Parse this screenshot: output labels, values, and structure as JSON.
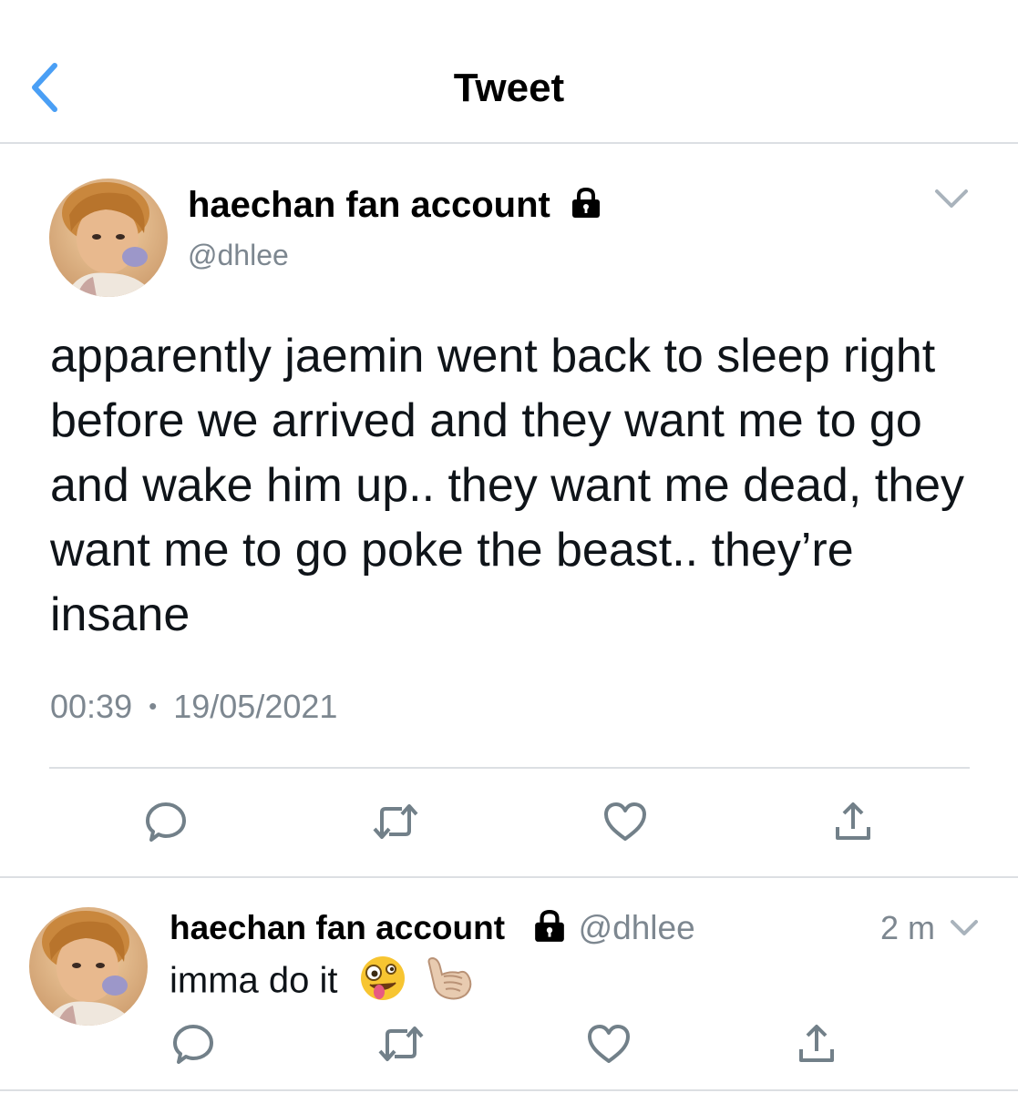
{
  "header": {
    "title": "Tweet",
    "back_icon": "chevron-left-icon"
  },
  "tweet": {
    "display_name": "haechan fan account",
    "handle": "@dhlee",
    "protected_icon": "lock-icon",
    "menu_icon": "chevron-down-icon",
    "text": "apparently jaemin went back to sleep right before we arrived and they want me to go and wake him up.. they want me dead, they want me to go poke the beast.. they’re insane",
    "time": "00:39",
    "separator": "•",
    "date": "19/05/2021",
    "actions": [
      "reply-icon",
      "retweet-icon",
      "like-icon",
      "share-icon"
    ]
  },
  "reply": {
    "display_name": "haechan fan account",
    "handle": "@dhlee",
    "age": "2 m",
    "text": "imma do it",
    "emojis": [
      "zany-face",
      "call-me-hand"
    ],
    "actions": [
      "reply-icon",
      "retweet-icon",
      "like-icon",
      "share-icon"
    ]
  },
  "colors": {
    "text": "#0f1419",
    "secondary": "#7d8790",
    "accent": "#4a9ff5",
    "divider": "#dcdfe3"
  }
}
